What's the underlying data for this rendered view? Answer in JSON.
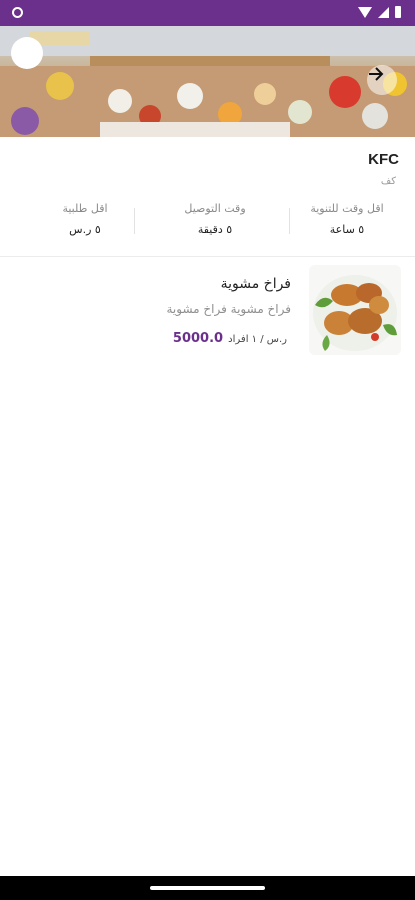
{
  "status_bar": {
    "color": "#6b2f8c"
  },
  "header": {
    "image": "buffet-food-photo",
    "back_icon": "arrow-right-icon"
  },
  "restaurant": {
    "name": "KFC",
    "subtitle": "كف"
  },
  "stats": [
    {
      "label": "اقل وقت للتنوية",
      "value": "٥ ساعة"
    },
    {
      "label": "وقت التوصيل",
      "value": "٥ دقيقة"
    },
    {
      "label": "اقل طلبية",
      "value": "٥ ر.س"
    }
  ],
  "menu_items": [
    {
      "title": "فراخ مشوية",
      "description": "فراخ مشوية فراخ مشوية",
      "price": "5000.0",
      "unit": "ر.س / ١ افراد",
      "image": "fried-chicken-photo"
    }
  ],
  "colors": {
    "accent": "#6b2f8c"
  }
}
